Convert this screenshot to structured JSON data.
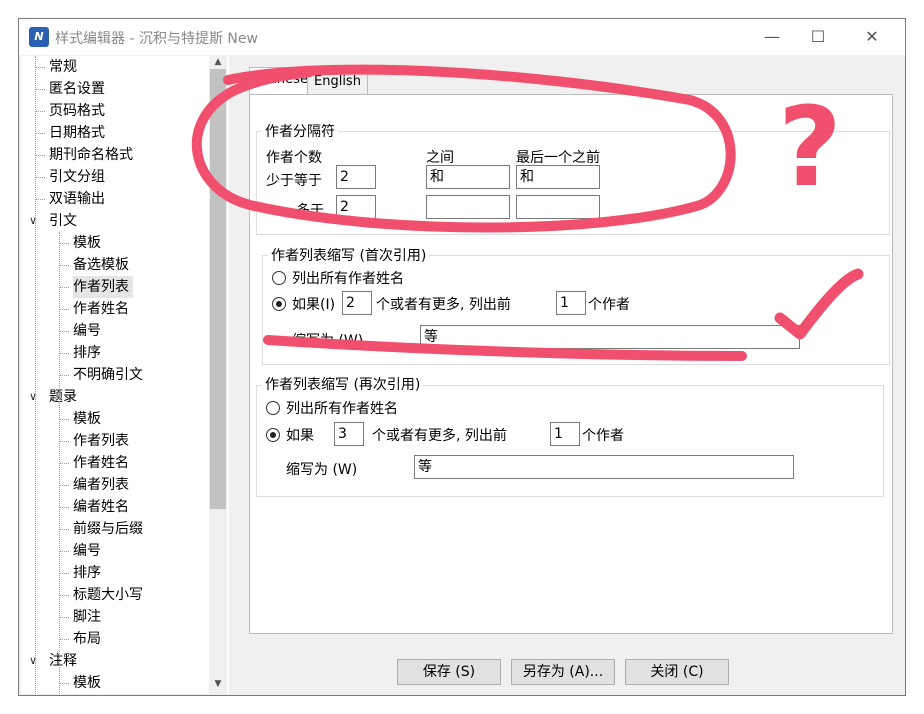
{
  "window": {
    "title": "样式编辑器 - 沉积与特提斯 New",
    "app_icon_text": "N",
    "controls": {
      "minimize": "—",
      "maximize": "☐",
      "close": "✕"
    }
  },
  "tree": {
    "items": [
      {
        "label": "常规"
      },
      {
        "label": "匿名设置"
      },
      {
        "label": "页码格式"
      },
      {
        "label": "日期格式"
      },
      {
        "label": "期刊命名格式"
      },
      {
        "label": "引文分组"
      },
      {
        "label": "双语输出"
      },
      {
        "label": "引文",
        "toggle": "∨"
      },
      {
        "label": "模板"
      },
      {
        "label": "备选模板"
      },
      {
        "label": "作者列表"
      },
      {
        "label": "作者姓名"
      },
      {
        "label": "编号"
      },
      {
        "label": "排序"
      },
      {
        "label": "不明确引文"
      },
      {
        "label": "题录",
        "toggle": "∨"
      },
      {
        "label": "模板"
      },
      {
        "label": "作者列表"
      },
      {
        "label": "作者姓名"
      },
      {
        "label": "编者列表"
      },
      {
        "label": "编者姓名"
      },
      {
        "label": "前缀与后缀"
      },
      {
        "label": "编号"
      },
      {
        "label": "排序"
      },
      {
        "label": "标题大小写"
      },
      {
        "label": "脚注"
      },
      {
        "label": "布局"
      },
      {
        "label": "注释",
        "toggle": "∨"
      },
      {
        "label": "模板"
      }
    ],
    "scroll_up": "▲",
    "scroll_down": "▼"
  },
  "tabs": [
    "Chinese",
    "English"
  ],
  "separator_group": {
    "title": "作者分隔符",
    "col_count": "作者个数",
    "col_between": "之间",
    "col_last": "最后一个之前",
    "row_less": "少于等于",
    "row_more": "多于",
    "less_count": "2",
    "less_between": "和",
    "less_last": "和",
    "more_count": "2",
    "more_between": "",
    "more_last": ""
  },
  "first_cite_group": {
    "title": "作者列表缩写 (首次引用)",
    "list_all": "列出所有作者姓名",
    "if_label": "如果(I)",
    "if_value": "2",
    "more_text": "个或者有更多, 列出前",
    "list_first_value": "1",
    "authors_text": "个作者",
    "abbrev_label": "缩写为 (W)",
    "abbrev_value": "等"
  },
  "subsequent_cite_group": {
    "title": "作者列表缩写 (再次引用)",
    "list_all": "列出所有作者姓名",
    "if_label": "如果",
    "if_value": "3",
    "more_text": "个或者有更多, 列出前",
    "list_first_value": "1",
    "authors_text": "个作者",
    "abbrev_label": "缩写为 (W)",
    "abbrev_value": "等"
  },
  "buttons": {
    "save": "保存 (S)",
    "save_as": "另存为 (A)...",
    "close": "关闭 (C)"
  },
  "annotation": {
    "color": "#f0506e",
    "question_mark": "?"
  }
}
